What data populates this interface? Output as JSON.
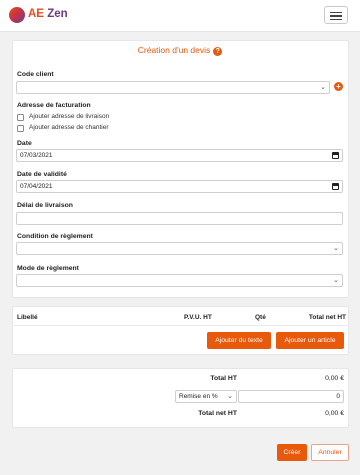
{
  "brand": {
    "prefix": "AE",
    "name": "Zen"
  },
  "form": {
    "title": "Création d'un devis",
    "help": "?",
    "code_client": {
      "label": "Code client",
      "value": ""
    },
    "adresse": {
      "label": "Adresse de facturation",
      "options": [
        "Ajouter adresse de livraison",
        "Ajouter adresse de chantier"
      ]
    },
    "date": {
      "label": "Date",
      "value": "07/03/2021"
    },
    "date_validite": {
      "label": "Date de validité",
      "value": "07/04/2021"
    },
    "delai": {
      "label": "Délai de livraison",
      "value": ""
    },
    "condition": {
      "label": "Condition de règlement",
      "value": ""
    },
    "mode": {
      "label": "Mode de règlement",
      "value": ""
    }
  },
  "lines": {
    "columns": [
      "Libellé",
      "P.V.U. HT",
      "Qté",
      "Total net HT"
    ],
    "add_text": "Ajouter du texte",
    "add_article": "Ajouter un article"
  },
  "totals": {
    "total_ht_label": "Total HT",
    "total_ht_value": "0,00 €",
    "remise_select": "Remise en %",
    "remise_value": "0",
    "total_net_label": "Total net HT",
    "total_net_value": "0,00 €"
  },
  "actions": {
    "create": "Créer",
    "cancel": "Annuler"
  }
}
